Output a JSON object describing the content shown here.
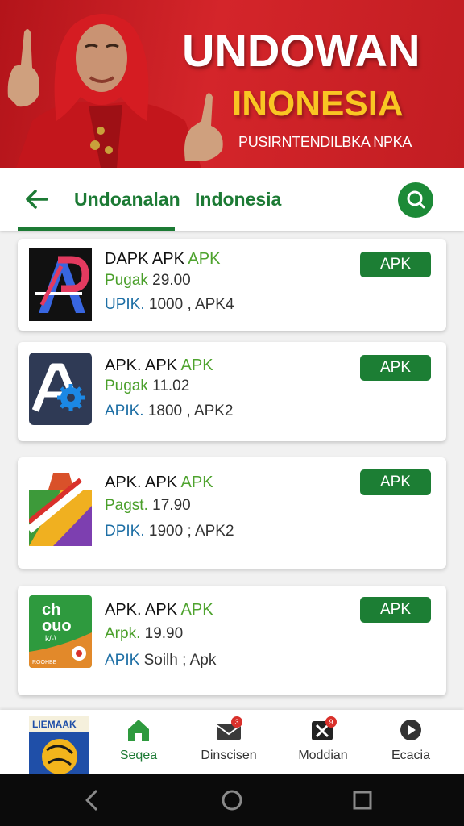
{
  "banner": {
    "title": "UNDOWAN",
    "subtitle": "INONESIA",
    "tagline": "PUSIRNTENDILBKA NPKA"
  },
  "tabs": {
    "items": [
      {
        "label": "Undoanalan"
      },
      {
        "label": "Indonesia"
      }
    ],
    "active_index": 0
  },
  "apps": [
    {
      "name": "DAPK APK ",
      "name_accent": "APK",
      "line2_label": "Pugak",
      "line2_value": "29.00",
      "line3_label": "UPIK.",
      "line3_value": "1000 , APK4",
      "button": "APK"
    },
    {
      "name": "APK. APK ",
      "name_accent": "APK",
      "line2_label": "Pugak",
      "line2_value": "11.02",
      "line3_label": "APIK.",
      "line3_value": "1800 , APK2",
      "button": "APK"
    },
    {
      "name": "APK. APK ",
      "name_accent": "APK",
      "line2_label": "Pagst.",
      "line2_value": "17.90",
      "line3_label": "DPIK.",
      "line3_value": "1900 ; APK2",
      "button": "APK"
    },
    {
      "name": "APK. APK ",
      "name_accent": "APK",
      "line2_label": "Arpk.",
      "line2_value": "19.90",
      "line3_label": "APIK",
      "line3_value": "Soilh ; Apk",
      "button": "APK"
    }
  ],
  "icon_texts": {
    "app4_main": "ch\nouo",
    "app4_small": "k/-\\",
    "app4_footer": "ROOHBE"
  },
  "bottom_nav": {
    "thumb_label": "LIEMAAK",
    "items": [
      {
        "label": "Seqea",
        "icon": "home-icon",
        "badge": ""
      },
      {
        "label": "Dinscisen",
        "icon": "mail-icon",
        "badge": "3"
      },
      {
        "label": "Moddian",
        "icon": "x-icon",
        "badge": "9"
      },
      {
        "label": "Ecacia",
        "icon": "play-icon",
        "badge": ""
      }
    ]
  },
  "colors": {
    "brand_green": "#1c7a34",
    "banner_red": "#c21d22",
    "accent_yellow": "#f9c623",
    "badge_red": "#d9302b"
  }
}
